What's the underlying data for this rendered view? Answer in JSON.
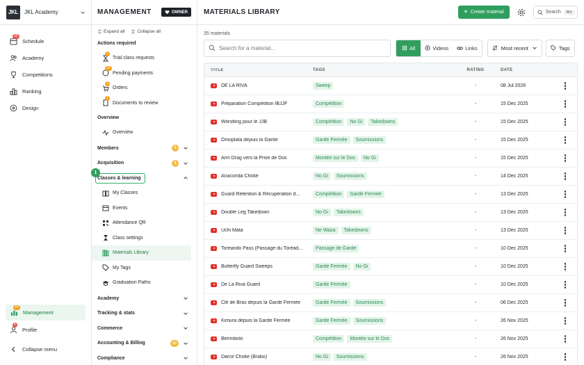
{
  "brand": {
    "logo": "JKL",
    "name": "JKL Academy"
  },
  "leftnav": {
    "items": [
      {
        "label": "Schedule",
        "icon": "calendar-icon",
        "badge": "20"
      },
      {
        "label": "Academy",
        "icon": "users-icon"
      },
      {
        "label": "Competitions",
        "icon": "trophy-icon"
      },
      {
        "label": "Ranking",
        "icon": "ranking-icon"
      },
      {
        "label": "Design",
        "icon": "palette-icon"
      }
    ],
    "management": {
      "label": "Management",
      "badge": "23"
    },
    "profile": {
      "label": "Profile",
      "badge": "6"
    },
    "collapse": "Collapse menu"
  },
  "mgmt": {
    "title": "MANAGEMENT",
    "owner": "OWNER",
    "expand_all": "Expand all",
    "collapse_all": "Collapse all",
    "actions_title": "Actions required",
    "actions": [
      {
        "label": "Trial class requests",
        "badge": "1"
      },
      {
        "label": "Pending payments",
        "badge": "10"
      },
      {
        "label": "Orders",
        "badge": "2"
      },
      {
        "label": "Documents to review",
        "badge": "1"
      }
    ],
    "overview_title": "Overview",
    "overview_item": "Overview",
    "members": {
      "label": "Members",
      "badge": "1"
    },
    "acquisition": {
      "label": "Acquisition",
      "badge": "1"
    },
    "classes": {
      "label": "Classes & learning",
      "step": "1"
    },
    "classes_items": [
      "My Classes",
      "Events",
      "Attendance QR",
      "Class settings",
      "Materials Library",
      "My Tags",
      "Graduation Paths"
    ],
    "groups": [
      {
        "label": "Academy"
      },
      {
        "label": "Tracking & stats"
      },
      {
        "label": "Commerce"
      },
      {
        "label": "Accounting & Billing",
        "badge": "10"
      },
      {
        "label": "Compliance"
      }
    ]
  },
  "main": {
    "title": "MATERIALS LIBRARY",
    "create": "Create material",
    "search": "Search",
    "kbd": "⌘K",
    "count": "35 materials",
    "search_placeholder": "Search for a material...",
    "filters": {
      "all": "All",
      "videos": "Videos",
      "links": "Links"
    },
    "sort": "Most recent",
    "tags": "Tags",
    "columns": {
      "title": "TITLE",
      "tags": "TAGS",
      "rating": "RATING",
      "date": "DATE"
    },
    "accent": "#2f9e5e",
    "rows": [
      {
        "title": "DE LA RIVA",
        "tags": [
          "Sweep"
        ],
        "rating": "-",
        "date": "08 Jul 2026"
      },
      {
        "title": "Préparation Compétition IBJJF",
        "tags": [
          "Compétition"
        ],
        "rating": "-",
        "date": "15 Dec 2025"
      },
      {
        "title": "Wrestling pour le JJB",
        "tags": [
          "Compétition",
          "No Gi",
          "Takedowns"
        ],
        "rating": "-",
        "date": "15 Dec 2025"
      },
      {
        "title": "Omoplata depuis la Garde",
        "tags": [
          "Garde Fermée",
          "Soumissions"
        ],
        "rating": "-",
        "date": "15 Dec 2025"
      },
      {
        "title": "Arm Drag vers la Prise de Dos",
        "tags": [
          "Montée sur le Dos",
          "No Gi"
        ],
        "rating": "-",
        "date": "15 Dec 2025"
      },
      {
        "title": "Anaconda Choke",
        "tags": [
          "No Gi",
          "Soumissions"
        ],
        "rating": "-",
        "date": "14 Dec 2025"
      },
      {
        "title": "Guard Retention & Récupération d...",
        "tags": [
          "Compétition",
          "Garde Fermée"
        ],
        "rating": "-",
        "date": "13 Dec 2025"
      },
      {
        "title": "Double Leg Takedown",
        "tags": [
          "No Gi",
          "Takedowns"
        ],
        "rating": "-",
        "date": "13 Dec 2025"
      },
      {
        "title": "Uchi Mata",
        "tags": [
          "Ne Waza",
          "Takedowns"
        ],
        "rating": "-",
        "date": "13 Dec 2025"
      },
      {
        "title": "Toreando Pass (Passage du Toréad...",
        "tags": [
          "Passage de Garde"
        ],
        "rating": "-",
        "date": "10 Dec 2025"
      },
      {
        "title": "Butterfly Guard Sweeps",
        "tags": [
          "Garde Fermée",
          "No Gi"
        ],
        "rating": "-",
        "date": "10 Dec 2025"
      },
      {
        "title": "De La Riva Guard",
        "tags": [
          "Garde Fermée"
        ],
        "rating": "-",
        "date": "10 Dec 2025"
      },
      {
        "title": "Clé de Bras depuis la Garde Fermée",
        "tags": [
          "Garde Fermée",
          "Soumissions"
        ],
        "rating": "-",
        "date": "06 Dec 2025"
      },
      {
        "title": "Kimura depuis la Garde Fermée",
        "tags": [
          "Garde Fermée",
          "Soumissions"
        ],
        "rating": "-",
        "date": "26 Nov 2025"
      },
      {
        "title": "Berimbolo",
        "tags": [
          "Compétition",
          "Montée sur le Dos"
        ],
        "rating": "-",
        "date": "26 Nov 2025"
      },
      {
        "title": "Darce Choke (Brabo)",
        "tags": [
          "No Gi",
          "Soumissions"
        ],
        "rating": "-",
        "date": "26 Nov 2025"
      }
    ]
  }
}
